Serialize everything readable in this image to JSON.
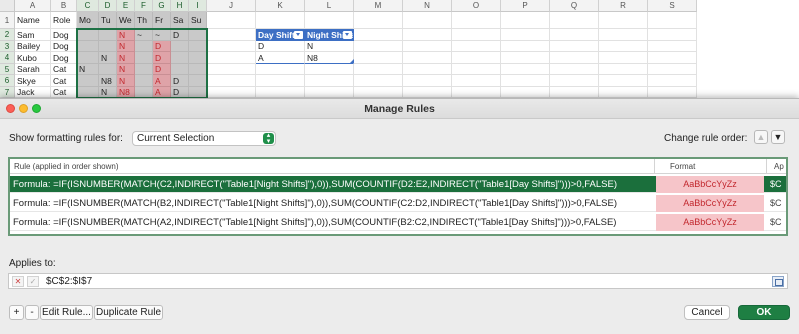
{
  "sheet": {
    "columns": [
      "A",
      "B",
      "C",
      "D",
      "E",
      "F",
      "G",
      "H",
      "I",
      "J",
      "K",
      "L",
      "M",
      "N",
      "O",
      "P",
      "Q",
      "R",
      "S"
    ],
    "rows": [
      "1",
      "2",
      "3",
      "4",
      "5",
      "6",
      "7"
    ],
    "headers": [
      "Name",
      "Role",
      "Mo",
      "Tu",
      "We",
      "Th",
      "Fr",
      "Sa",
      "Su"
    ],
    "data": [
      [
        "Sam",
        "Dog",
        "",
        "",
        "N",
        "~",
        "~",
        "D",
        ""
      ],
      [
        "Bailey",
        "Dog",
        "",
        "",
        "N",
        "",
        "D",
        "",
        ""
      ],
      [
        "Kubo",
        "Dog",
        "",
        "N",
        "N",
        "",
        "D",
        "",
        ""
      ],
      [
        "Sarah",
        "Cat",
        "N",
        "",
        "N",
        "",
        "D",
        "",
        ""
      ],
      [
        "Skye",
        "Cat",
        "",
        "N8",
        "N",
        "",
        "A",
        "D",
        ""
      ],
      [
        "Jack",
        "Cat",
        "",
        "N",
        "N8",
        "",
        "A",
        "D",
        ""
      ]
    ],
    "table": {
      "headers": [
        "Day Shifts",
        "Night Shifts"
      ],
      "rows": [
        [
          "D",
          "N"
        ],
        [
          "A",
          "N8"
        ]
      ]
    }
  },
  "dialog": {
    "title": "Manage Rules",
    "show_rules_label": "Show formatting rules for:",
    "scope_value": "Current Selection",
    "change_order_label": "Change rule order:",
    "rules_header": {
      "rule": "Rule (applied in order shown)",
      "format": "Format",
      "applies": "Ap"
    },
    "rules": [
      {
        "formula": "Formula: =IF(ISNUMBER(MATCH(C2,INDIRECT(\"Table1[Night Shifts]\"),0)),SUM(COUNTIF(D2:E2,INDIRECT(\"Table1[Day Shifts]\")))>0,FALSE)",
        "format_preview": "AaBbCcYyZz",
        "applies": "$C"
      },
      {
        "formula": "Formula: =IF(ISNUMBER(MATCH(B2,INDIRECT(\"Table1[Night Shifts]\"),0)),SUM(COUNTIF(C2:D2,INDIRECT(\"Table1[Day Shifts]\")))>0,FALSE)",
        "format_preview": "AaBbCcYyZz",
        "applies": "$C"
      },
      {
        "formula": "Formula: =IF(ISNUMBER(MATCH(A2,INDIRECT(\"Table1[Night Shifts]\"),0)),SUM(COUNTIF(B2:C2,INDIRECT(\"Table1[Day Shifts]\")))>0,FALSE)",
        "format_preview": "AaBbCcYyZz",
        "applies": "$C"
      }
    ],
    "applies_to_label": "Applies to:",
    "applies_to_value": "$C$2:$I$7",
    "buttons": {
      "add": "+",
      "remove": "-",
      "edit": "Edit Rule...",
      "duplicate": "Duplicate Rule",
      "cancel": "Cancel",
      "ok": "OK"
    }
  }
}
